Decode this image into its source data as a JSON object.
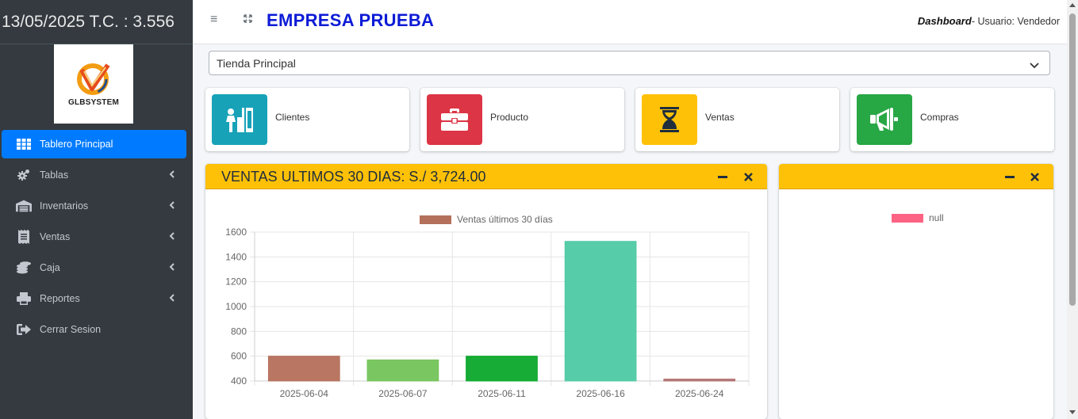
{
  "sidebar": {
    "header_text": "13/05/2025 T.C. : 3.556",
    "logo_text": "GLBSYSTEM",
    "items": [
      {
        "label": "Tablero Principal",
        "icon": "grid-icon",
        "active": true,
        "has_chevron": false
      },
      {
        "label": "Tablas",
        "icon": "cogs-icon",
        "active": false,
        "has_chevron": true
      },
      {
        "label": "Inventarios",
        "icon": "warehouse-icon",
        "active": false,
        "has_chevron": true
      },
      {
        "label": "Ventas",
        "icon": "receipt-icon",
        "active": false,
        "has_chevron": true
      },
      {
        "label": "Caja",
        "icon": "coins-icon",
        "active": false,
        "has_chevron": true
      },
      {
        "label": "Reportes",
        "icon": "printer-icon",
        "active": false,
        "has_chevron": true
      },
      {
        "label": "Cerrar Sesion",
        "icon": "sign-out-icon",
        "active": false,
        "has_chevron": false
      }
    ]
  },
  "topbar": {
    "brand": "EMPRESA PRUEBA",
    "page_label": "Dashboard",
    "user_text": "- Usuario: Vendedor"
  },
  "store_select": {
    "value": "Tienda Principal"
  },
  "info_boxes": [
    {
      "label": "Clientes",
      "color": "#17a2b8",
      "icon": "client-desk-icon"
    },
    {
      "label": "Producto",
      "color": "#dc3545",
      "icon": "toolbox-icon"
    },
    {
      "label": "Ventas",
      "color": "#ffc107",
      "icon": "hourglass-icon"
    },
    {
      "label": "Compras",
      "color": "#28a745",
      "icon": "megaphone-icon"
    }
  ],
  "sales_card": {
    "title": "VENTAS ULTIMOS 30 DIAS: S./ 3,724.00",
    "header_color": "#ffc107"
  },
  "right_card": {
    "legend_label": "null",
    "legend_color": "#ff6384"
  },
  "chart_data": {
    "type": "bar",
    "title": "",
    "categories": [
      "2025-06-04",
      "2025-06-07",
      "2025-06-11",
      "2025-06-16",
      "2025-06-24"
    ],
    "series": [
      {
        "name": "Ventas últimos 30 días",
        "values": [
          600,
          570,
          600,
          1525,
          415
        ],
        "colors": [
          "#b5705b",
          "#73c45a",
          "#0aa82a",
          "#4ec9a4",
          "#b07070"
        ]
      }
    ],
    "legend_color": "#b5705b",
    "legend_position": "top",
    "ylim": [
      400,
      1600
    ],
    "yticks": [
      "1600",
      "1400",
      "1200",
      "1000",
      "800",
      "600",
      "400"
    ],
    "grid": true
  }
}
